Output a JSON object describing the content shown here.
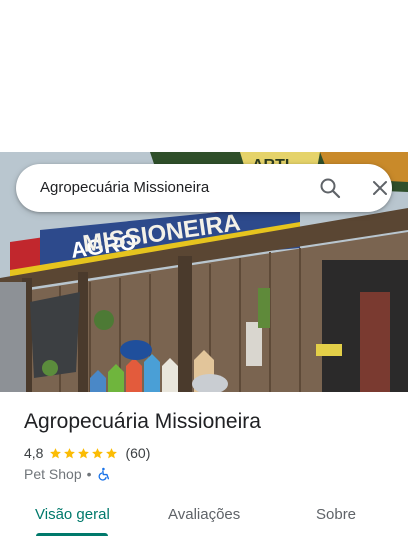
{
  "search": {
    "query": "Agropecuária Missioneira"
  },
  "photo": {
    "sign_text": "MISSIONEIRA",
    "sign_prefix": "AGRO",
    "sign_top_text": "ARTI"
  },
  "place": {
    "name": "Agropecuária Missioneira",
    "rating": "4,8",
    "stars": 5,
    "review_count": "(60)",
    "category": "Pet Shop",
    "separator": "•",
    "accessibility": "wheelchair-accessible"
  },
  "tabs": [
    {
      "label": "Visão geral",
      "active": true
    },
    {
      "label": "Avaliações",
      "active": false
    },
    {
      "label": "Sobre",
      "active": false
    }
  ],
  "colors": {
    "accent": "#00796b",
    "star": "#fbbc04",
    "wheelchair": "#1a73e8"
  }
}
